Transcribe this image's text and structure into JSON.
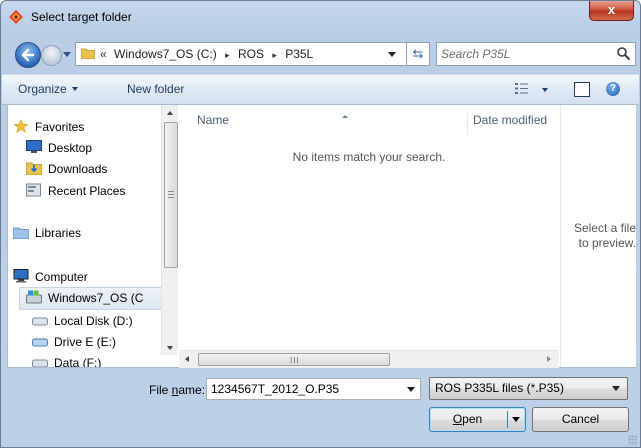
{
  "window": {
    "title": "Select target folder",
    "close_label": "x"
  },
  "address_bar": {
    "overflow": "«",
    "crumbs": [
      "Windows7_OS (C:)",
      "ROS",
      "P35L"
    ],
    "separator": "▸"
  },
  "search": {
    "placeholder": "Search P35L"
  },
  "toolbar": {
    "organize_label": "Organize",
    "new_folder_label": "New folder",
    "help_label": "?"
  },
  "nav_pane": {
    "items": [
      {
        "label": "Favorites",
        "icon": "star-icon"
      },
      {
        "label": "Desktop",
        "icon": "desktop-icon"
      },
      {
        "label": "Downloads",
        "icon": "downloads-icon"
      },
      {
        "label": "Recent Places",
        "icon": "recent-places-icon"
      },
      {
        "label": "Libraries",
        "icon": "libraries-icon"
      },
      {
        "label": "Computer",
        "icon": "computer-icon"
      },
      {
        "label": "Windows7_OS (C",
        "icon": "drive-os-icon"
      },
      {
        "label": "Local Disk (D:)",
        "icon": "drive-icon"
      },
      {
        "label": "Drive E (E:)",
        "icon": "drive-icon"
      },
      {
        "label": "Data (F:)",
        "icon": "drive-icon"
      }
    ]
  },
  "file_list": {
    "columns": [
      "Name",
      "Date modified"
    ],
    "empty_message": "No items match your search."
  },
  "preview": {
    "line1": "Select a file",
    "line2": "to preview."
  },
  "bottom": {
    "file_name_label_pre": "File ",
    "file_name_label_u": "n",
    "file_name_label_post": "ame:",
    "file_name_value": "1234567T_2012_O.P35",
    "file_type": "ROS P335L files (*.P35)",
    "open_u": "O",
    "open_rest": "pen",
    "cancel_label": "Cancel"
  },
  "colors": {
    "frame": "#bcd0e8",
    "close_button": "#cc4b32",
    "selected_item": "#dde6f1"
  }
}
